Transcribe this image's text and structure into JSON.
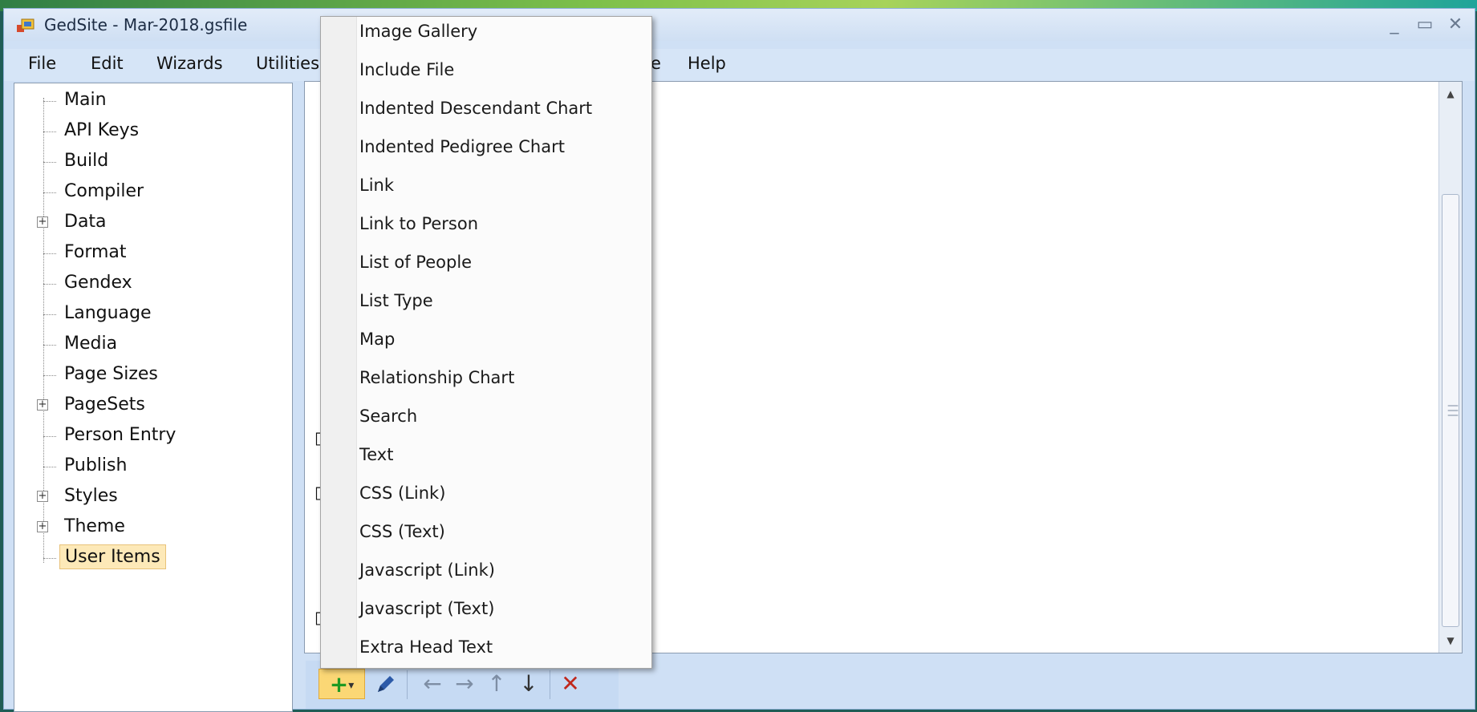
{
  "window": {
    "title": "GedSite - Mar-2018.gsfile"
  },
  "menubar": {
    "items": [
      "File",
      "Edit",
      "Wizards",
      "Utilities",
      "e",
      "Help"
    ]
  },
  "tree": {
    "items": [
      {
        "label": "Main",
        "expandable": false
      },
      {
        "label": "API Keys",
        "expandable": false
      },
      {
        "label": "Build",
        "expandable": false
      },
      {
        "label": "Compiler",
        "expandable": false
      },
      {
        "label": "Data",
        "expandable": true
      },
      {
        "label": "Format",
        "expandable": false
      },
      {
        "label": "Gendex",
        "expandable": false
      },
      {
        "label": "Language",
        "expandable": false
      },
      {
        "label": "Media",
        "expandable": false
      },
      {
        "label": "Page Sizes",
        "expandable": false
      },
      {
        "label": "PageSets",
        "expandable": true
      },
      {
        "label": "Person Entry",
        "expandable": false
      },
      {
        "label": "Publish",
        "expandable": false
      },
      {
        "label": "Styles",
        "expandable": true
      },
      {
        "label": "Theme",
        "expandable": true
      },
      {
        "label": "User Items",
        "expandable": false,
        "selected": true
      }
    ]
  },
  "dropdown": {
    "items": [
      "Image Gallery",
      "Include File",
      "Indented Descendant Chart",
      "Indented Pedigree Chart",
      "Link",
      "Link to Person",
      "List of People",
      "List Type",
      "Map",
      "Relationship Chart",
      "Search",
      "Text",
      "CSS (Link)",
      "CSS (Text)",
      "Javascript (Link)",
      "Javascript (Text)",
      "Extra Head Text"
    ]
  },
  "toolbar": {
    "add_icon": "+",
    "dropdown_caret": "▾",
    "edit_icon": "pencil-icon",
    "arrows": [
      "←",
      "→",
      "↑",
      "↓"
    ],
    "delete_icon": "✕"
  },
  "colors": {
    "selection": "#fde9b8",
    "add_button": "#fbd775",
    "delete": "#c0281c"
  }
}
